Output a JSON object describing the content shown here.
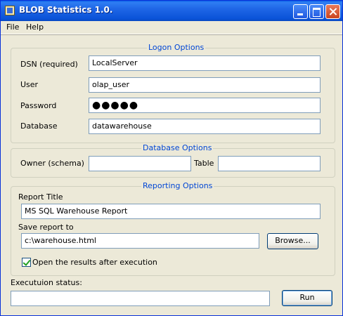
{
  "window": {
    "title": "BLOB Statistics 1.0."
  },
  "menu": {
    "file": "File",
    "help": "Help"
  },
  "logon": {
    "legend": "Logon Options",
    "dsn_label": "DSN (required)",
    "dsn_value": "LocalServer",
    "user_label": "User",
    "user_value": "olap_user",
    "password_label": "Password",
    "password_mask": "●●●●●",
    "database_label": "Database",
    "database_value": "datawarehouse"
  },
  "database_options": {
    "legend": "Database Options",
    "owner_label": "Owner (schema)",
    "owner_value": "",
    "table_label": "Table",
    "table_value": ""
  },
  "reporting": {
    "legend": "Reporting Options",
    "title_label": "Report Title",
    "title_value": "MS SQL Warehouse Report",
    "save_label": "Save report to",
    "save_value": "c:\\warehouse.html",
    "browse_button": "Browse...",
    "open_results_label": "Open the results after execution",
    "open_results_checked": true
  },
  "status": {
    "label": "Executuion status:",
    "value": ""
  },
  "run_button": "Run"
}
